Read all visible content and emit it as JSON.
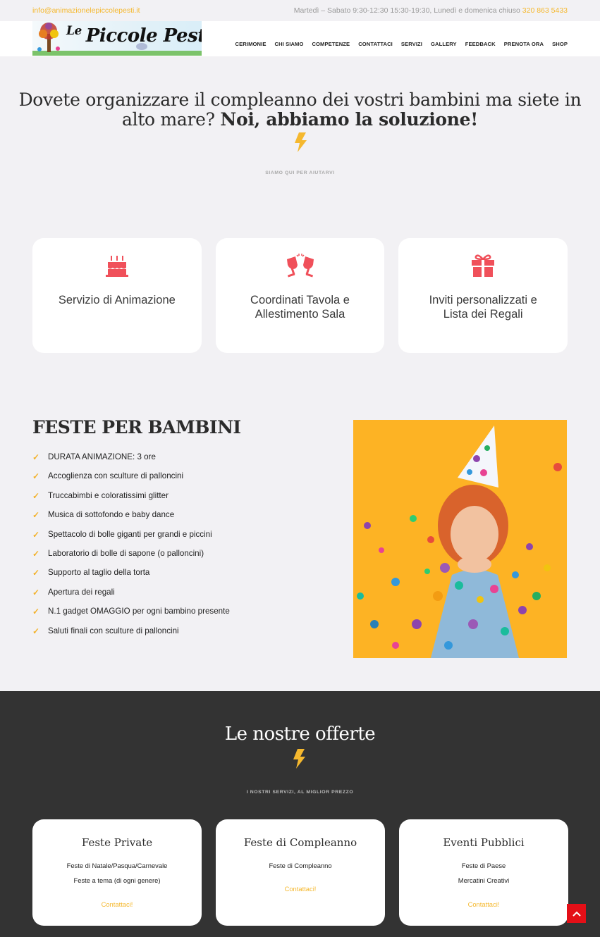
{
  "topbar": {
    "email": "info@animazionelepiccolepesti.it",
    "hours": "Martedì – Sabato 9:30-12:30 15:30-19:30, Lunedì e domenica chiuso",
    "phone": "320 863 5433"
  },
  "logo": {
    "prefix": "Le",
    "name": "Piccole Pesti"
  },
  "nav": [
    "CERIMONIE",
    "CHI SIAMO",
    "COMPETENZE",
    "CONTATTACI",
    "SERVIZI",
    "GALLERY",
    "FEEDBACK",
    "PRENOTA ORA",
    "SHOP"
  ],
  "hero": {
    "title_part1": "Dovete organizzare il compleanno dei vostri bambini ma siete in alto mare?",
    "title_part2": "Noi, abbiamo la soluzione!",
    "subtitle": "SIAMO QUI PER AIUTARVI"
  },
  "features": [
    {
      "icon": "birthday-cake-icon",
      "label": "Servizio di Animazione"
    },
    {
      "icon": "glasses-cheers-icon",
      "label": "Coordinati Tavola e Allestimento Sala"
    },
    {
      "icon": "gift-icon",
      "label": "Inviti personalizzati e Lista dei Regali"
    }
  ],
  "feste": {
    "title": "FESTE PER BAMBINI",
    "items": [
      "DURATA ANIMAZIONE: 3 ore",
      "Accoglienza con sculture di palloncini",
      "Truccabimbi e coloratissimi glitter",
      "Musica di sottofondo e baby dance",
      "Spettacolo di bolle giganti per grandi e piccini",
      "Laboratorio di bolle di sapone (o palloncini)",
      "Supporto al taglio della torta",
      "Apertura dei regali",
      "N.1 gadget OMAGGIO per ogni bambino presente",
      "Saluti finali con sculture di palloncini"
    ]
  },
  "offerte": {
    "title": "Le nostre offerte",
    "subtitle": "I NOSTRI SERVIZI, AL MIGLIOR PREZZO",
    "cards": [
      {
        "title": "Feste Private",
        "lines": [
          "Feste di Natale/Pasqua/Carnevale",
          "Feste a tema (di ogni genere)"
        ],
        "cta": "Contattaci!"
      },
      {
        "title": "Feste di Compleanno",
        "lines": [
          "Feste di Compleanno"
        ],
        "cta": "Contattaci!"
      },
      {
        "title": "Eventi Pubblici",
        "lines": [
          "Feste di Paese",
          "Mercatini Creativi"
        ],
        "cta": "Contattaci!"
      }
    ]
  },
  "colors": {
    "accent": "#f5b82e",
    "icon_red": "#f0505a",
    "dark": "#333333",
    "scroll_top": "#e40f17"
  }
}
